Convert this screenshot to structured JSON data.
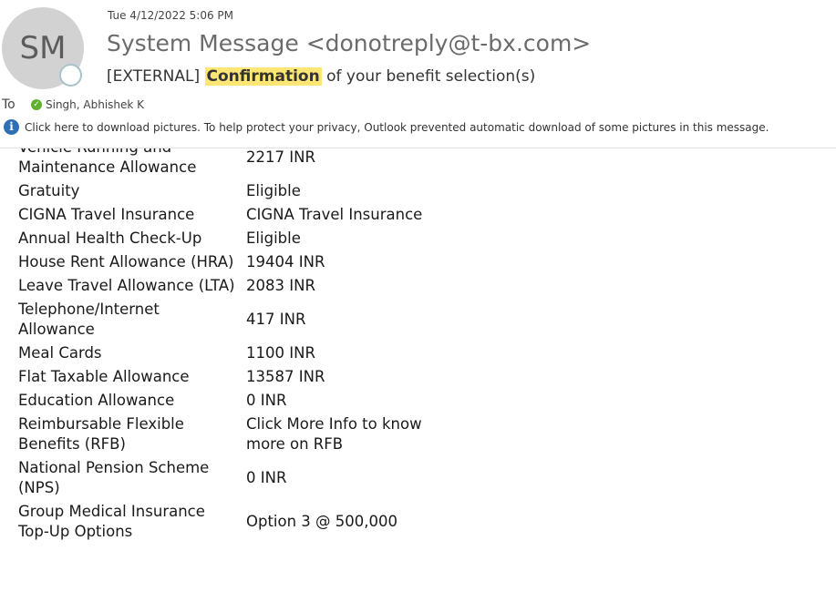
{
  "header": {
    "avatar_initials": "SM",
    "date": "Tue 4/12/2022 5:06 PM",
    "sender": "System Message <donotreply@t-bx.com>",
    "subject_prefix": "[EXTERNAL] ",
    "subject_highlight": "Confirmation",
    "subject_suffix": " of your benefit selection(s)",
    "to_label": "To",
    "recipient": "Singh, Abhishek K",
    "info_message": "Click here to download pictures. To help protect your privacy, Outlook prevented automatic download of some pictures in this message."
  },
  "benefits": [
    {
      "name": "Vehicle Running and Maintenance Allowance",
      "value": "2217 INR"
    },
    {
      "name": "Gratuity",
      "value": "Eligible"
    },
    {
      "name": "CIGNA Travel Insurance",
      "value": "CIGNA Travel Insurance"
    },
    {
      "name": "Annual Health Check-Up",
      "value": "Eligible"
    },
    {
      "name": "House Rent Allowance (HRA)",
      "value": "19404 INR"
    },
    {
      "name": "Leave Travel Allowance (LTA)",
      "value": "2083 INR"
    },
    {
      "name": "Telephone/Internet Allowance",
      "value": "417 INR"
    },
    {
      "name": "Meal Cards",
      "value": "1100 INR"
    },
    {
      "name": "Flat Taxable Allowance",
      "value": "13587 INR"
    },
    {
      "name": "Education Allowance",
      "value": "0 INR"
    },
    {
      "name": "Reimbursable Flexible Benefits (RFB)",
      "value": "Click More Info to know more on RFB"
    },
    {
      "name": "National Pension Scheme (NPS)",
      "value": "0 INR"
    },
    {
      "name": "Group Medical Insurance Top-Up Options",
      "value": "Option 3 @ 500,000"
    }
  ]
}
